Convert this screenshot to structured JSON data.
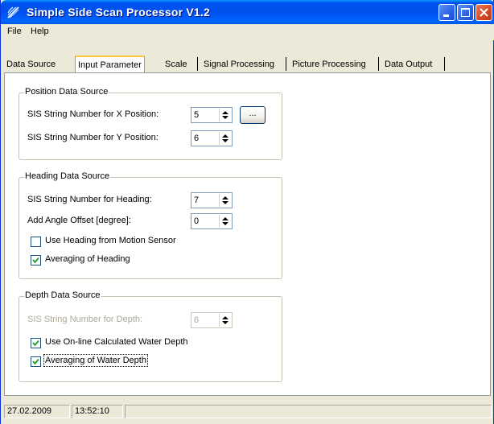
{
  "window": {
    "title": "Simple Side Scan Processor V1.2"
  },
  "menu": {
    "items": [
      "File",
      "Help"
    ]
  },
  "tabs": [
    "Data Source",
    "Input Parameter",
    "Scale",
    "Signal Processing",
    "Picture Processing",
    "Data Output"
  ],
  "active_tab": "Input Parameter",
  "position_group": {
    "title": "Position Data Source",
    "x_label": "SIS String Number for X Position:",
    "x_value": "5",
    "browse_label": "...",
    "y_label": "SIS String Number for Y Position:",
    "y_value": "6"
  },
  "heading_group": {
    "title": "Heading Data Source",
    "heading_label": "SIS String Number for Heading:",
    "heading_value": "7",
    "offset_label": "Add Angle Offset [degree]:",
    "offset_value": "0",
    "motion_sensor_label": "Use Heading from Motion Sensor",
    "motion_sensor_checked": false,
    "averaging_label": "Averaging of Heading",
    "averaging_checked": true
  },
  "depth_group": {
    "title": "Depth Data Source",
    "depth_label": "SIS String Number for Depth:",
    "depth_value": "6",
    "online_label": "Use On-line Calculated Water Depth",
    "online_checked": true,
    "averaging_label": "Averaging of Water Depth",
    "averaging_checked": true
  },
  "status": {
    "date": "27.02.2009",
    "time": "13:52:10"
  }
}
